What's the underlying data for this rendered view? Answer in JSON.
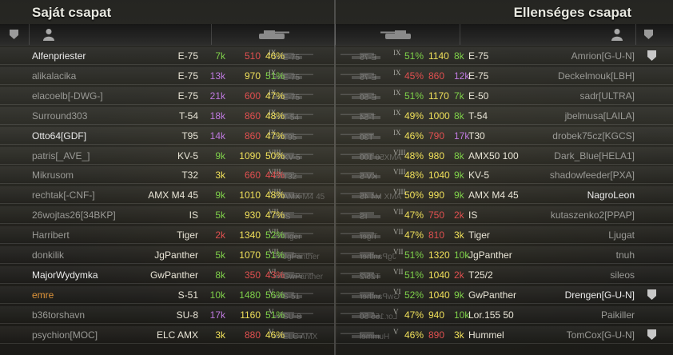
{
  "teams": {
    "left_title": "Saját csapat",
    "right_title": "Ellenséges csapat"
  },
  "colors": {
    "green": "#7fd14a",
    "red": "#e05050",
    "purple": "#c07ae0",
    "yellow": "#f0e05a",
    "orange": "#e0953a",
    "white": "#ececec"
  },
  "header_icons": {
    "left": [
      "clan-shield-icon",
      "player-silhouette-icon",
      "tank-icon"
    ],
    "right": [
      "tank-icon",
      "player-silhouette-icon",
      "clan-shield-icon"
    ]
  },
  "left_team": [
    {
      "player": "Alfenpriester",
      "tank": "E-75",
      "tier": "IX",
      "tank_label": "E-75",
      "battles": "7k",
      "rating": "510",
      "winrate": "46%",
      "state": "alive",
      "bc": "green",
      "rc": "red",
      "wc": "yellow",
      "shield": false
    },
    {
      "player": "alikalacika",
      "tank": "E-75",
      "tier": "IX",
      "tank_label": "E-75",
      "battles": "13k",
      "rating": "970",
      "winrate": "51%",
      "state": "dead",
      "bc": "purple",
      "rc": "yellow",
      "wc": "green",
      "shield": false
    },
    {
      "player": "elacoelb[-DWG-]",
      "tank": "E-75",
      "tier": "IX",
      "tank_label": "E-75",
      "battles": "21k",
      "rating": "600",
      "winrate": "47%",
      "state": "dead",
      "bc": "purple",
      "rc": "red",
      "wc": "yellow",
      "shield": false
    },
    {
      "player": "Surround303",
      "tank": "T-54",
      "tier": "IX",
      "tank_label": "T-54",
      "battles": "18k",
      "rating": "860",
      "winrate": "48%",
      "state": "dead",
      "bc": "purple",
      "rc": "red",
      "wc": "yellow",
      "shield": false
    },
    {
      "player": "Otto64[GDF]",
      "tank": "T95",
      "tier": "IX",
      "tank_label": "T95",
      "battles": "14k",
      "rating": "860",
      "winrate": "47%",
      "state": "alive",
      "bc": "purple",
      "rc": "red",
      "wc": "yellow",
      "shield": false
    },
    {
      "player": "patris[_AVE_]",
      "tank": "KV-5",
      "tier": "VIII",
      "tank_label": "KV-5",
      "battles": "9k",
      "rating": "1090",
      "winrate": "50%",
      "state": "dead",
      "bc": "green",
      "rc": "yellow",
      "wc": "yellow",
      "shield": false
    },
    {
      "player": "Mikrusom",
      "tank": "T32",
      "tier": "VIII",
      "tank_label": "T32",
      "battles": "3k",
      "rating": "660",
      "winrate": "44%",
      "state": "dead",
      "bc": "yellow",
      "rc": "red",
      "wc": "red",
      "shield": false
    },
    {
      "player": "rechtak[-CNF-]",
      "tank": "AMX M4 45",
      "tier": "VIII",
      "tank_label": "AMX M4 45",
      "battles": "9k",
      "rating": "1010",
      "winrate": "48%",
      "state": "dead",
      "bc": "green",
      "rc": "yellow",
      "wc": "yellow",
      "shield": false
    },
    {
      "player": "26wojtas26[34BKP]",
      "tank": "IS",
      "tier": "VII",
      "tank_label": "IS",
      "battles": "5k",
      "rating": "930",
      "winrate": "47%",
      "state": "dead",
      "bc": "green",
      "rc": "yellow",
      "wc": "yellow",
      "shield": false
    },
    {
      "player": "Harribert",
      "tank": "Tiger",
      "tier": "VII",
      "tank_label": "Tiger",
      "battles": "2k",
      "rating": "1340",
      "winrate": "52%",
      "state": "dead",
      "bc": "red",
      "rc": "yellow",
      "wc": "green",
      "shield": false
    },
    {
      "player": "donkilik",
      "tank": "JgPanther",
      "tier": "VII",
      "tank_label": "JgPanther",
      "battles": "5k",
      "rating": "1070",
      "winrate": "51%",
      "state": "dead",
      "bc": "green",
      "rc": "yellow",
      "wc": "green",
      "shield": false
    },
    {
      "player": "MajorWydymka",
      "tank": "GwPanther",
      "tier": "VI",
      "tank_label": "GwPanther",
      "battles": "8k",
      "rating": "350",
      "winrate": "43%",
      "state": "alive",
      "bc": "green",
      "rc": "red",
      "wc": "red",
      "shield": false
    },
    {
      "player": "emre",
      "tank": "S-51",
      "tier": "V",
      "tank_label": "S-51",
      "battles": "10k",
      "rating": "1480",
      "winrate": "56%",
      "state": "highlight",
      "bc": "green",
      "rc": "green",
      "wc": "green",
      "shield": false
    },
    {
      "player": "b36torshavn",
      "tank": "SU-8",
      "tier": "V",
      "tank_label": "SU-8",
      "battles": "17k",
      "rating": "1160",
      "winrate": "51%",
      "state": "dead",
      "bc": "purple",
      "rc": "yellow",
      "wc": "green",
      "shield": false
    },
    {
      "player": "psychion[MOC]",
      "tank": "ELC AMX",
      "tier": "V",
      "tank_label": "ELC AMX",
      "battles": "3k",
      "rating": "880",
      "winrate": "46%",
      "state": "dead",
      "bc": "yellow",
      "rc": "red",
      "wc": "yellow",
      "shield": false
    }
  ],
  "right_team": [
    {
      "player": "Amrion[G-U-N]",
      "tank": "E-75",
      "tier": "IX",
      "tank_label": "E-75",
      "battles": "8k",
      "rating": "1140",
      "winrate": "51%",
      "state": "dead",
      "bc": "green",
      "rc": "yellow",
      "wc": "green",
      "shield": true
    },
    {
      "player": "Deckelmouk[LBH]",
      "tank": "E-75",
      "tier": "IX",
      "tank_label": "E-75",
      "battles": "12k",
      "rating": "860",
      "winrate": "45%",
      "state": "dead",
      "bc": "purple",
      "rc": "red",
      "wc": "red",
      "shield": false
    },
    {
      "player": "sadr[ULTRA]",
      "tank": "E-50",
      "tier": "IX",
      "tank_label": "E-50",
      "battles": "7k",
      "rating": "1170",
      "winrate": "51%",
      "state": "dead",
      "bc": "green",
      "rc": "yellow",
      "wc": "green",
      "shield": false
    },
    {
      "player": "jbelmusa[LAILA]",
      "tank": "T-54",
      "tier": "IX",
      "tank_label": "T-54",
      "battles": "8k",
      "rating": "1000",
      "winrate": "49%",
      "state": "dead",
      "bc": "green",
      "rc": "yellow",
      "wc": "yellow",
      "shield": false
    },
    {
      "player": "drobek75cz[KGCS]",
      "tank": "T30",
      "tier": "IX",
      "tank_label": "T30",
      "battles": "17k",
      "rating": "790",
      "winrate": "46%",
      "state": "dead",
      "bc": "purple",
      "rc": "red",
      "wc": "yellow",
      "shield": false
    },
    {
      "player": "Dark_Blue[HELA1]",
      "tank": "AMX50 100",
      "tier": "VIII",
      "tank_label": "AMX50 100",
      "battles": "8k",
      "rating": "980",
      "winrate": "48%",
      "state": "dead",
      "bc": "green",
      "rc": "yellow",
      "wc": "yellow",
      "shield": false
    },
    {
      "player": "shadowfeeder[PXA]",
      "tank": "KV-5",
      "tier": "VIII",
      "tank_label": "KV-5",
      "battles": "9k",
      "rating": "1040",
      "winrate": "48%",
      "state": "dead",
      "bc": "green",
      "rc": "yellow",
      "wc": "yellow",
      "shield": false
    },
    {
      "player": "NagroLeon",
      "tank": "AMX M4 45",
      "tier": "VIII",
      "tank_label": "AMX M4 45",
      "battles": "9k",
      "rating": "990",
      "winrate": "50%",
      "state": "alive",
      "bc": "green",
      "rc": "yellow",
      "wc": "yellow",
      "shield": false
    },
    {
      "player": "kutaszenko2[PPAP]",
      "tank": "IS",
      "tier": "VII",
      "tank_label": "IS",
      "battles": "2k",
      "rating": "750",
      "winrate": "47%",
      "state": "dead",
      "bc": "red",
      "rc": "red",
      "wc": "yellow",
      "shield": false
    },
    {
      "player": "Ljugat",
      "tank": "Tiger",
      "tier": "VII",
      "tank_label": "Tiger",
      "battles": "3k",
      "rating": "810",
      "winrate": "47%",
      "state": "dead",
      "bc": "yellow",
      "rc": "red",
      "wc": "yellow",
      "shield": false
    },
    {
      "player": "tnuh",
      "tank": "JgPanther",
      "tier": "VII",
      "tank_label": "JgPanther",
      "battles": "10k",
      "rating": "1320",
      "winrate": "51%",
      "state": "dead",
      "bc": "green",
      "rc": "yellow",
      "wc": "green",
      "shield": false
    },
    {
      "player": "sileos",
      "tank": "T25/2",
      "tier": "VII",
      "tank_label": "T25/2",
      "battles": "2k",
      "rating": "1040",
      "winrate": "51%",
      "state": "dead",
      "bc": "red",
      "rc": "yellow",
      "wc": "green",
      "shield": false
    },
    {
      "player": "Drengen[G-U-N]",
      "tank": "GwPanther",
      "tier": "VI",
      "tank_label": "GwPanther",
      "battles": "9k",
      "rating": "1040",
      "winrate": "52%",
      "state": "alive",
      "bc": "green",
      "rc": "yellow",
      "wc": "green",
      "shield": true
    },
    {
      "player": "Paikiller",
      "tank": "Lor.155 50",
      "tier": "V",
      "tank_label": "Lor.155 50",
      "battles": "10k",
      "rating": "940",
      "winrate": "47%",
      "state": "dead",
      "bc": "green",
      "rc": "yellow",
      "wc": "yellow",
      "shield": false
    },
    {
      "player": "TomCox[G-U-N]",
      "tank": "Hummel",
      "tier": "V",
      "tank_label": "Hummel",
      "battles": "3k",
      "rating": "890",
      "winrate": "46%",
      "state": "dead",
      "bc": "yellow",
      "rc": "red",
      "wc": "yellow",
      "shield": true
    }
  ]
}
